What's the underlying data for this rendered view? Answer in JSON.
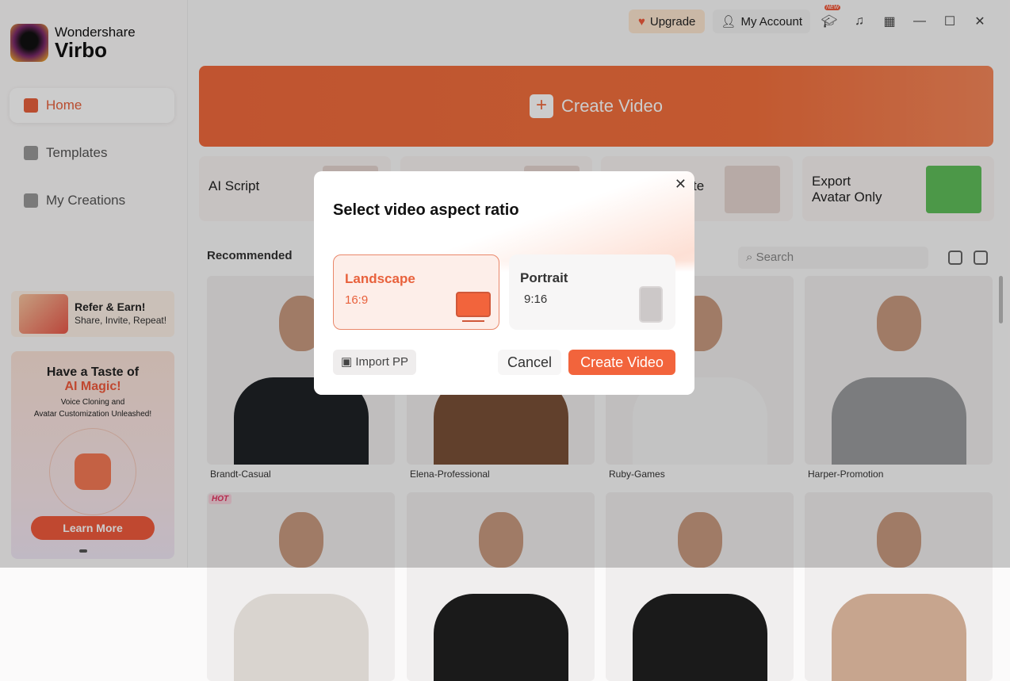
{
  "app": {
    "brand_line1": "Wondershare",
    "brand_line2": "Virbo"
  },
  "sidebar": {
    "items": [
      {
        "label": "Home",
        "active": true
      },
      {
        "label": "Templates"
      },
      {
        "label": "My Creations"
      }
    ],
    "refer": {
      "title": "Refer & Earn!",
      "subtitle": "Share, Invite, Repeat!"
    },
    "promo": {
      "title1": "Have a Taste of",
      "title2": "AI Magic!",
      "line1": "Voice Cloning and",
      "line2": "Avatar Customization Unleashed!",
      "button": "Learn More"
    }
  },
  "topbar": {
    "upgrade": "Upgrade",
    "account": "My Account",
    "new_badge": "NEW"
  },
  "hero": {
    "label": "Create Video"
  },
  "features": [
    {
      "label": "AI Script"
    },
    {
      "label": ""
    },
    {
      "label": "te"
    },
    {
      "label": "Export\nAvatar Only"
    }
  ],
  "recommended": {
    "title": "Recommended",
    "search_placeholder": "Search"
  },
  "avatars": [
    {
      "name": "Brandt-Casual"
    },
    {
      "name": "Elena-Professional"
    },
    {
      "name": "Ruby-Games"
    },
    {
      "name": "Harper-Promotion"
    },
    {
      "name": "",
      "badge": "HOT"
    },
    {
      "name": ""
    },
    {
      "name": ""
    },
    {
      "name": ""
    }
  ],
  "dialog": {
    "title": "Select video aspect ratio",
    "options": [
      {
        "label": "Landscape",
        "ratio": "16:9",
        "selected": true
      },
      {
        "label": "Portrait",
        "ratio": "9:16",
        "selected": false
      }
    ],
    "import": "Import PP",
    "cancel": "Cancel",
    "create": "Create Video"
  },
  "colors": {
    "accent": "#f2643c"
  }
}
